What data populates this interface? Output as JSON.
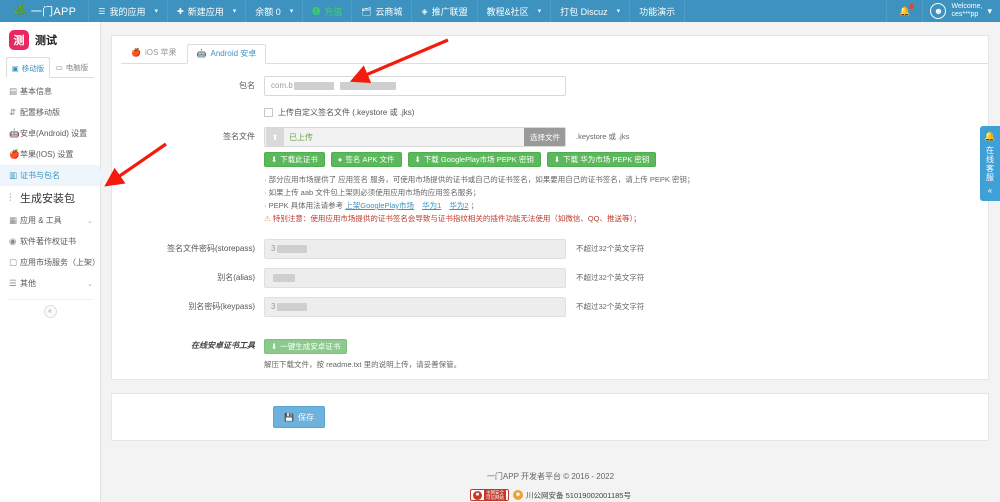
{
  "topnav": {
    "brand": "一门APP",
    "brand_icon": "leaf-icon",
    "items": [
      {
        "label": "我的应用",
        "icon": "list-icon",
        "caret": true
      },
      {
        "label": "新建应用",
        "icon": "plus-icon",
        "caret": true
      },
      {
        "label": "余额 0",
        "icon": "",
        "caret": true
      },
      {
        "label": "充值",
        "icon": "money-icon",
        "caret": false,
        "green": true
      },
      {
        "label": "云商城",
        "icon": "shop-icon",
        "caret": false
      },
      {
        "label": "推广联盟",
        "icon": "share-icon",
        "caret": false
      },
      {
        "label": "教程&社区",
        "icon": "",
        "caret": true
      },
      {
        "label": "打包 Discuz",
        "icon": "",
        "caret": true
      },
      {
        "label": "功能演示",
        "icon": "",
        "caret": false
      }
    ],
    "bell_icon": "bell-icon",
    "has_notification_dot": true,
    "user_greeting": "Welcome,",
    "user_name": "ces***pp",
    "user_caret": "▾",
    "accent_color": "#3d92bf"
  },
  "sidebar": {
    "app_icon_text": "测",
    "app_name": "测试",
    "platform_tabs": [
      {
        "label": "移动版",
        "icon": "mobile-icon",
        "active": true
      },
      {
        "label": "电脑版",
        "icon": "desktop-icon",
        "active": false
      }
    ],
    "items": [
      {
        "label": "基本信息",
        "icon": "info-icon",
        "active": false,
        "chev": "",
        "big": false
      },
      {
        "label": "配置移动版",
        "icon": "sliders-icon",
        "active": false,
        "chev": "",
        "big": false
      },
      {
        "label": "安卓(Android) 设置",
        "icon": "android-icon",
        "active": false,
        "chev": "",
        "big": false
      },
      {
        "label": "苹果(IOS) 设置",
        "icon": "apple-icon",
        "active": false,
        "chev": "",
        "big": false
      },
      {
        "label": "证书与包名",
        "icon": "certificate-icon",
        "active": true,
        "chev": "",
        "big": false
      },
      {
        "label": "生成安装包",
        "icon": "package-icon",
        "active": false,
        "chev": "",
        "big": true
      },
      {
        "label": "应用 & 工具",
        "icon": "grid-icon",
        "active": false,
        "chev": "⌄",
        "big": false
      },
      {
        "label": "软件著作权证书",
        "icon": "copyright-icon",
        "active": false,
        "chev": "",
        "big": false
      },
      {
        "label": "应用市场服务（上架）",
        "icon": "store-icon",
        "active": false,
        "chev": "",
        "big": false
      },
      {
        "label": "其他",
        "icon": "menu-icon",
        "active": false,
        "chev": "⌄",
        "big": false
      }
    ],
    "collapse_icon": "«"
  },
  "main": {
    "tabs": [
      {
        "label": "iOS 苹果",
        "icon": "apple-icon",
        "active": false
      },
      {
        "label": "Android 安卓",
        "icon": "android-icon",
        "active": true
      }
    ],
    "package": {
      "label": "包名",
      "value_prefix": "com.b",
      "redacted": true
    },
    "custom_sign": {
      "checkbox_label": "上传自定义签名文件 (.keystore 或 .jks)",
      "checked": false
    },
    "signfile": {
      "label": "签名文件",
      "upload_icon": "upload-icon",
      "status_text": "已上传",
      "choose_button": "选择文件",
      "side_hint": ".keystore 或 .jks",
      "buttons": [
        {
          "label": "下载此证书",
          "icon": "download-icon"
        },
        {
          "label": "签名 APK 文件",
          "icon": "dot-icon"
        },
        {
          "label": "下载 GooglePlay市场 PEPK 密钥",
          "icon": "download-icon"
        },
        {
          "label": "下载 华为市场 PEPK 密钥",
          "icon": "download-icon"
        }
      ],
      "notes": [
        "· 部分应用市场提供了 应用签名 服务，可使用市场提供的证书或自己的证书签名，如果要用自己的证书签名，请上传 PEPK 密钥；",
        "· 如果上传 aab 文件包上架则必须使用应用市场的应用签名服务；"
      ],
      "note_links_line": {
        "prefix": "· PEPK 具体用法请参考",
        "links": [
          "上架GooglePlay市场",
          "华为1",
          "华为2"
        ],
        "suffix": "；"
      },
      "warning": "特别注意：使用应用市场提供的证书签名会导致与证书指纹相关的插件功能无法使用（如微信、QQ、推送等）；",
      "warning_icon": "warning-icon"
    },
    "fields": [
      {
        "label": "签名文件密码(storepass)",
        "value_prefix": "3",
        "hint": "不超过32个英文字符",
        "redacted": true
      },
      {
        "label": "别名(alias)",
        "value_prefix": "",
        "hint": "不超过32个英文字符",
        "redacted": true
      },
      {
        "label": "别名密码(keypass)",
        "value_prefix": "3",
        "hint": "不超过32个英文字符",
        "redacted": true
      }
    ],
    "cert_tool": {
      "label": "在线安卓证书工具",
      "button": "一键生成安卓证书",
      "button_icon": "download-icon",
      "note": "解压下载文件，按 readme.txt 里的说明上传，请妥善保管。"
    },
    "save": {
      "label": "保存",
      "icon": "save-icon"
    }
  },
  "footer": {
    "copyright": "一门APP 开发者平台 © 2016 - 2022",
    "icp_badge_line1": "主网安全",
    "icp_badge_line2": "可信网站",
    "beian_text": "川公网安备 51019002001185号"
  },
  "service_rail": {
    "bell_icon": "bell-icon",
    "text": "在线客服",
    "collapse": "«"
  },
  "annotations": {
    "arrow_color": "#f41b0c",
    "arrows": [
      {
        "name": "arrow-to-package-name"
      },
      {
        "name": "arrow-to-sidebar-certificate"
      }
    ]
  }
}
